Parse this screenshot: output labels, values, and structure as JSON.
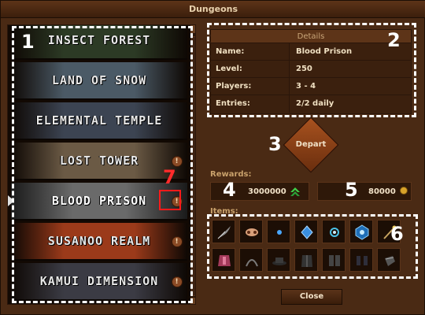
{
  "window": {
    "title": "Dungeons"
  },
  "dungeons": [
    {
      "name": "INSECT FOREST",
      "locked": false
    },
    {
      "name": "LAND OF SNOW",
      "locked": false
    },
    {
      "name": "ELEMENTAL TEMPLE",
      "locked": false
    },
    {
      "name": "LOST TOWER",
      "locked": true
    },
    {
      "name": "BLOOD PRISON",
      "locked": true,
      "selected": true
    },
    {
      "name": "SUSANOO REALM",
      "locked": true
    },
    {
      "name": "KAMUI DIMENSION",
      "locked": true
    }
  ],
  "row_colors": [
    "#2c3a25",
    "#4b5a66",
    "#3c4452",
    "#6b5a45",
    "#5e5e5e",
    "#9b3a1a",
    "#3b3b44"
  ],
  "details": {
    "header": "Details",
    "rows": [
      {
        "key": "Name:",
        "value": "Blood Prison"
      },
      {
        "key": "Level:",
        "value": "250"
      },
      {
        "key": "Players:",
        "value": "3 - 4"
      },
      {
        "key": "Entries:",
        "value": "2/2 daily"
      }
    ]
  },
  "depart_label": "Depart",
  "rewards": {
    "label": "Rewards:",
    "exp": "3000000",
    "gold": "80000"
  },
  "items": {
    "label": "Items:",
    "icons": [
      "feather-icon",
      "mask-icon",
      "orb-icon",
      "blue-gem-icon",
      "ring-icon",
      "shield-gem-icon",
      "staff-icon",
      "armor-icon",
      "chain-icon",
      "hat-icon",
      "vest-icon",
      "gauntlet-icon",
      "boots-icon",
      "glove-icon"
    ]
  },
  "close_label": "Close",
  "markers": [
    "1",
    "2",
    "3",
    "4",
    "5",
    "6",
    "7"
  ],
  "warn_glyph": "!"
}
